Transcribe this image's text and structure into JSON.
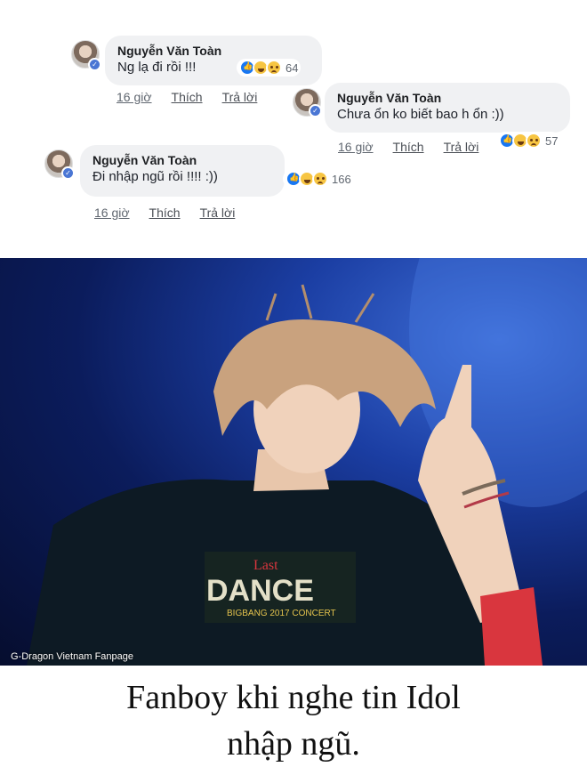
{
  "comments": [
    {
      "author": "Nguyễn Văn Toàn",
      "text": "Ng lạ đi rồi !!!",
      "reaction_count": "64",
      "time": "16 giờ",
      "like_label": "Thích",
      "reply_label": "Trả lời"
    },
    {
      "author": "Nguyễn Văn Toàn",
      "text": "Chưa ổn ko biết bao h ổn :))",
      "reaction_count": "57",
      "time": "16 giờ",
      "like_label": "Thích",
      "reply_label": "Trả lời"
    },
    {
      "author": "Nguyễn Văn Toàn",
      "text": "Đi nhập ngũ rồi !!!! :))",
      "reaction_count": "166",
      "time": "16 giờ",
      "like_label": "Thích",
      "reply_label": "Trả lời"
    }
  ],
  "photo": {
    "watermark": "G-Dragon Vietnam Fanpage",
    "shirt_text_top": "Last",
    "shirt_text_main": "DANCE",
    "shirt_text_sub": "BIGBANG 2017 CONCERT",
    "colors": {
      "stage_blue": "#1b3ea3",
      "hair": "#c9a27e",
      "shirt": "#0d1a24"
    }
  },
  "caption": {
    "line1": "Fanboy khi nghe tin Idol",
    "line2": "nhập ngũ."
  }
}
